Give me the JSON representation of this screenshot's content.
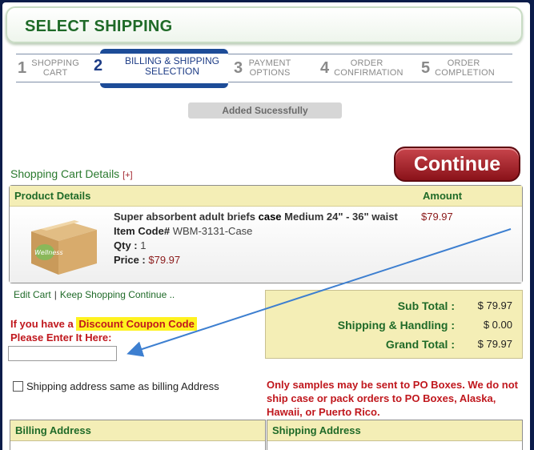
{
  "header": {
    "title": "SELECT SHIPPING"
  },
  "steps": [
    {
      "num": "1",
      "label": "Shopping Cart"
    },
    {
      "num": "2",
      "label": "Billing & Shipping Selection"
    },
    {
      "num": "3",
      "label": "Payment Options"
    },
    {
      "num": "4",
      "label": "Order Confirmation"
    },
    {
      "num": "5",
      "label": "Order Completion"
    }
  ],
  "notice": "Added Sucessfully",
  "cart": {
    "title": "Shopping Cart Details",
    "toggle": "[+]",
    "continue_label": "Continue",
    "col_product": "Product Details",
    "col_amount": "Amount",
    "item": {
      "name_pre": "Super absorbent adult briefs",
      "name_bold": "case",
      "name_post": "Medium 24\" - 36\" waist",
      "code_label": "Item Code#",
      "code": "WBM-3131-Case",
      "qty_label": "Qty :",
      "qty": "1",
      "price_label": "Price :",
      "price": "$79.97",
      "amount": "$79.97",
      "image_brand": "Wellness"
    }
  },
  "links": {
    "edit": "Edit Cart",
    "keep": "Keep Shopping Continue .."
  },
  "totals": {
    "sub_label": "Sub Total :",
    "sub_value": "$ 79.97",
    "ship_label": "Shipping & Handling :",
    "ship_value": "$ 0.00",
    "grand_label": "Grand Total :",
    "grand_value": "$ 79.97"
  },
  "coupon": {
    "line1_pre": "If you have a",
    "line1_hl": "Discount Coupon Code",
    "line2": "Please Enter It Here:",
    "value": ""
  },
  "same_address_label": "Shipping address same as billing Address",
  "po_note": "Only samples may be sent to PO Boxes. We do not ship case or pack orders to PO Boxes, Alaska, Hawaii, or Puerto Rico.",
  "billing_title": "Billing Address",
  "shipping_title": "Shipping Address",
  "colors": {
    "green": "#1f6a28",
    "red": "#c0171d",
    "navy": "#1d4c98",
    "yellow_panel": "#f4eeb6"
  }
}
